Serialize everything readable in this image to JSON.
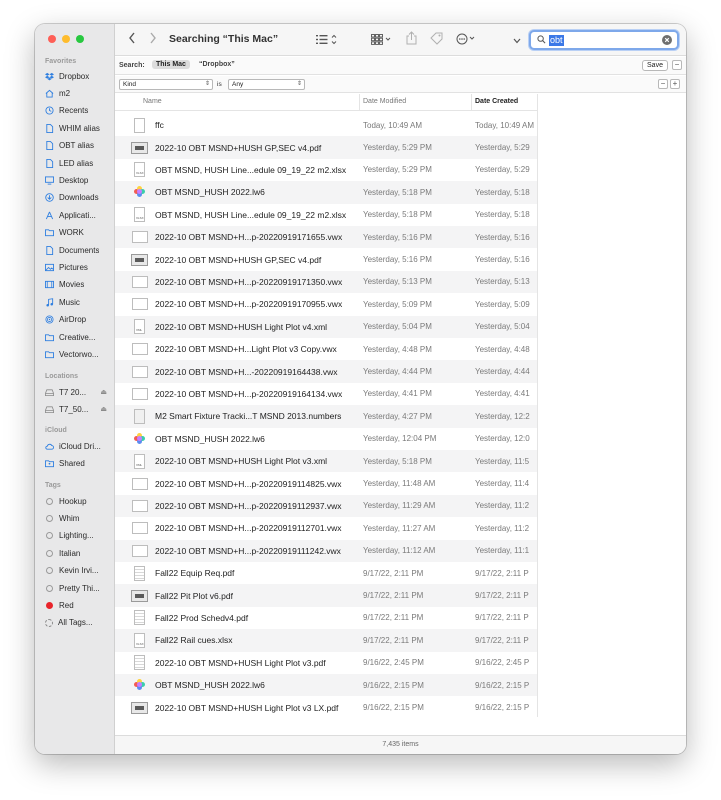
{
  "window": {
    "title": "Searching “This Mac”"
  },
  "sidebar": {
    "favorites_header": "Favorites",
    "favorites": [
      {
        "label": "Dropbox",
        "icon": "dropbox-icon"
      },
      {
        "label": "m2",
        "icon": "home-icon"
      },
      {
        "label": "Recents",
        "icon": "clock-icon"
      },
      {
        "label": "WHIM alias",
        "icon": "document-icon"
      },
      {
        "label": "OBT alias",
        "icon": "document-icon"
      },
      {
        "label": "LED alias",
        "icon": "document-icon"
      },
      {
        "label": "Desktop",
        "icon": "desktop-icon"
      },
      {
        "label": "Downloads",
        "icon": "download-icon"
      },
      {
        "label": "Applicati...",
        "icon": "applications-icon"
      },
      {
        "label": "WORK",
        "icon": "folder-icon"
      },
      {
        "label": "Documents",
        "icon": "document-icon"
      },
      {
        "label": "Pictures",
        "icon": "pictures-icon"
      },
      {
        "label": "Movies",
        "icon": "movies-icon"
      },
      {
        "label": "Music",
        "icon": "music-icon"
      },
      {
        "label": "AirDrop",
        "icon": "airdrop-icon"
      },
      {
        "label": "Creative...",
        "icon": "folder-icon"
      },
      {
        "label": "Vectorwo...",
        "icon": "folder-icon"
      }
    ],
    "locations_header": "Locations",
    "locations": [
      {
        "label": "T7 20...",
        "icon": "drive-icon"
      },
      {
        "label": "T7_50...",
        "icon": "drive-icon"
      }
    ],
    "icloud_header": "iCloud",
    "icloud": [
      {
        "label": "iCloud Dri...",
        "icon": "cloud-icon"
      },
      {
        "label": "Shared",
        "icon": "shared-folder-icon"
      }
    ],
    "tags_header": "Tags",
    "tags": [
      {
        "label": "Hookup",
        "color": ""
      },
      {
        "label": "Whim",
        "color": ""
      },
      {
        "label": "Lighting...",
        "color": ""
      },
      {
        "label": "Italian",
        "color": ""
      },
      {
        "label": "Kevin Irvi...",
        "color": ""
      },
      {
        "label": "Pretty Thi...",
        "color": ""
      },
      {
        "label": "Red",
        "color": "#e8242b"
      },
      {
        "label": "All Tags...",
        "color": ""
      }
    ]
  },
  "search": {
    "value": "obt"
  },
  "scope": {
    "label": "Search:",
    "this_mac": "This Mac",
    "dropbox": "“Dropbox”",
    "save": "Save"
  },
  "criteria": {
    "attribute": "Kind",
    "operator": "is",
    "value": "Any"
  },
  "columns": {
    "name": "Name",
    "modified": "Date Modified",
    "created": "Date Created"
  },
  "files": [
    {
      "name": "ffc",
      "modified": "Today, 10:49 AM",
      "created": "Today, 10:49 AM",
      "icon": "blank-doc"
    },
    {
      "name": "2022-10 OBT MSND+HUSH GP,SEC v4.pdf",
      "modified": "Yesterday, 5:29 PM",
      "created": "Yesterday, 5:29",
      "icon": "pdf"
    },
    {
      "name": "OBT MSND, HUSH Line...edule 09_19_22 m2.xlsx",
      "modified": "Yesterday, 5:29 PM",
      "created": "Yesterday, 5:29",
      "icon": "xlsx"
    },
    {
      "name": "OBT MSND_HUSH 2022.lw6",
      "modified": "Yesterday, 5:18 PM",
      "created": "Yesterday, 5:18",
      "icon": "lw6"
    },
    {
      "name": "OBT MSND, HUSH Line...edule 09_19_22 m2.xlsx",
      "modified": "Yesterday, 5:18 PM",
      "created": "Yesterday, 5:18",
      "icon": "xlsx"
    },
    {
      "name": "2022-10 OBT MSND+H...p-20220919171655.vwx",
      "modified": "Yesterday, 5:16 PM",
      "created": "Yesterday, 5:16",
      "icon": "vwx"
    },
    {
      "name": "2022-10 OBT MSND+HUSH GP,SEC v4.pdf",
      "modified": "Yesterday, 5:16 PM",
      "created": "Yesterday, 5:16",
      "icon": "pdf"
    },
    {
      "name": "2022-10 OBT MSND+H...p-20220919171350.vwx",
      "modified": "Yesterday, 5:13 PM",
      "created": "Yesterday, 5:13",
      "icon": "vwx"
    },
    {
      "name": "2022-10 OBT MSND+H...p-20220919170955.vwx",
      "modified": "Yesterday, 5:09 PM",
      "created": "Yesterday, 5:09",
      "icon": "vwx"
    },
    {
      "name": "2022-10 OBT MSND+HUSH Light Plot v4.xml",
      "modified": "Yesterday, 5:04 PM",
      "created": "Yesterday, 5:04",
      "icon": "xml"
    },
    {
      "name": "2022-10 OBT MSND+H...Light Plot v3 Copy.vwx",
      "modified": "Yesterday, 4:48 PM",
      "created": "Yesterday, 4:48",
      "icon": "vwx"
    },
    {
      "name": "2022-10 OBT MSND+H...-20220919164438.vwx",
      "modified": "Yesterday, 4:44 PM",
      "created": "Yesterday, 4:44",
      "icon": "vwx"
    },
    {
      "name": "2022-10 OBT MSND+H...p-20220919164134.vwx",
      "modified": "Yesterday, 4:41 PM",
      "created": "Yesterday, 4:41",
      "icon": "vwx"
    },
    {
      "name": "M2 Smart Fixture Tracki...T MSND 2013.numbers",
      "modified": "Yesterday, 4:27 PM",
      "created": "Yesterday, 12:2",
      "icon": "numbers"
    },
    {
      "name": "OBT MSND_HUSH 2022.lw6",
      "modified": "Yesterday, 12:04 PM",
      "created": "Yesterday, 12:0",
      "icon": "lw6"
    },
    {
      "name": "2022-10 OBT MSND+HUSH Light Plot v3.xml",
      "modified": "Yesterday, 5:18 PM",
      "created": "Yesterday, 11:5",
      "icon": "xml"
    },
    {
      "name": "2022-10 OBT MSND+H...p-20220919114825.vwx",
      "modified": "Yesterday, 11:48 AM",
      "created": "Yesterday, 11:4",
      "icon": "vwx"
    },
    {
      "name": "2022-10 OBT MSND+H...p-20220919112937.vwx",
      "modified": "Yesterday, 11:29 AM",
      "created": "Yesterday, 11:2",
      "icon": "vwx"
    },
    {
      "name": "2022-10 OBT MSND+H...p-20220919112701.vwx",
      "modified": "Yesterday, 11:27 AM",
      "created": "Yesterday, 11:2",
      "icon": "vwx"
    },
    {
      "name": "2022-10 OBT MSND+H...p-20220919111242.vwx",
      "modified": "Yesterday, 11:12 AM",
      "created": "Yesterday, 11:1",
      "icon": "vwx"
    },
    {
      "name": "Fall22 Equip Req.pdf",
      "modified": "9/17/22, 2:11 PM",
      "created": "9/17/22, 2:11 P",
      "icon": "pdf-page"
    },
    {
      "name": "Fall22 Pit Plot v6.pdf",
      "modified": "9/17/22, 2:11 PM",
      "created": "9/17/22, 2:11 P",
      "icon": "pdf"
    },
    {
      "name": "Fall22 Prod Schedv4.pdf",
      "modified": "9/17/22, 2:11 PM",
      "created": "9/17/22, 2:11 P",
      "icon": "pdf-page"
    },
    {
      "name": "Fall22 Rail cues.xlsx",
      "modified": "9/17/22, 2:11 PM",
      "created": "9/17/22, 2:11 P",
      "icon": "xlsx"
    },
    {
      "name": "2022-10 OBT MSND+HUSH Light Plot v3.pdf",
      "modified": "9/16/22, 2:45 PM",
      "created": "9/16/22, 2:45 P",
      "icon": "pdf-page"
    },
    {
      "name": "OBT MSND_HUSH 2022.lw6",
      "modified": "9/16/22, 2:15 PM",
      "created": "9/16/22, 2:15 P",
      "icon": "lw6"
    },
    {
      "name": "2022-10 OBT MSND+HUSH Light Plot v3 LX.pdf",
      "modified": "9/16/22, 2:15 PM",
      "created": "9/16/22, 2:15 P",
      "icon": "pdf"
    }
  ],
  "status": {
    "item_count": "7,435 items"
  },
  "colors": {
    "accent": "#3b78e7",
    "tag_red": "#e8242b",
    "sidebar_icon": "#2f7fe0"
  }
}
